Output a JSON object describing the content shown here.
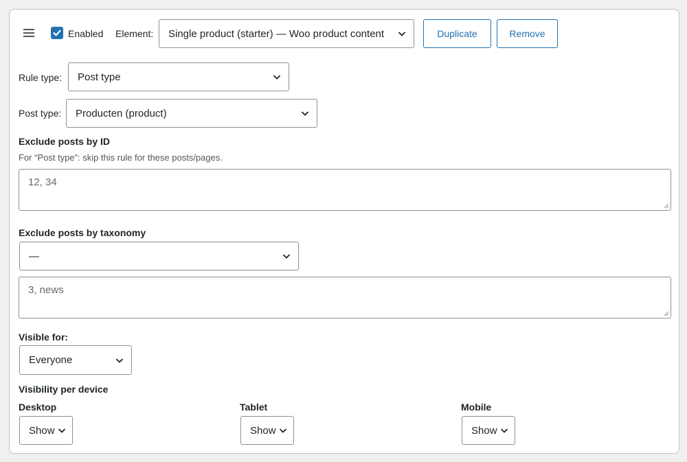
{
  "header": {
    "enabled_label": "Enabled",
    "enabled_checked": true,
    "element_label": "Element:",
    "element_value": "Single product (starter) — Woo product content",
    "duplicate_label": "Duplicate",
    "remove_label": "Remove"
  },
  "rule": {
    "rule_type_label": "Rule type:",
    "rule_type_value": "Post type",
    "post_type_label": "Post type:",
    "post_type_value": "Producten (product)"
  },
  "exclude_ids": {
    "heading": "Exclude posts by ID",
    "help": "For “Post type”: skip this rule for these posts/pages.",
    "placeholder": "12, 34"
  },
  "exclude_taxonomy": {
    "heading": "Exclude posts by taxonomy",
    "select_value": "—",
    "placeholder": "3, news"
  },
  "visibility": {
    "visible_for_label": "Visible for:",
    "visible_for_value": "Everyone",
    "per_device_heading": "Visibility per device",
    "devices": [
      {
        "label": "Desktop",
        "value": "Show"
      },
      {
        "label": "Tablet",
        "value": "Show"
      },
      {
        "label": "Mobile",
        "value": "Show"
      }
    ]
  },
  "colors": {
    "accent": "#2271b1",
    "border": "#8c8f94",
    "text": "#1d2327",
    "placeholder": "#646970"
  }
}
